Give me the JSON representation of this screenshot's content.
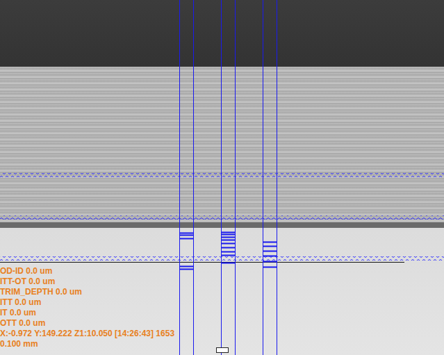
{
  "camera_view": {
    "kind": "photograph"
  },
  "readouts": [
    {
      "label": "OD-ID",
      "value": "0.0 um"
    },
    {
      "label": "ITT-OT",
      "value": "0.0 um"
    },
    {
      "label": "TRIM_DEPTH",
      "value": "0.0 um"
    },
    {
      "label": "ITT",
      "value": "0.0 um"
    },
    {
      "label": "IT",
      "value": "0.0 um"
    },
    {
      "label": "OTT",
      "value": "0.0 um"
    }
  ],
  "status_line": "X:-0.972 Y:149.222 Z1:10.050 [14:26:43] 1653",
  "scale": "0.100 mm"
}
